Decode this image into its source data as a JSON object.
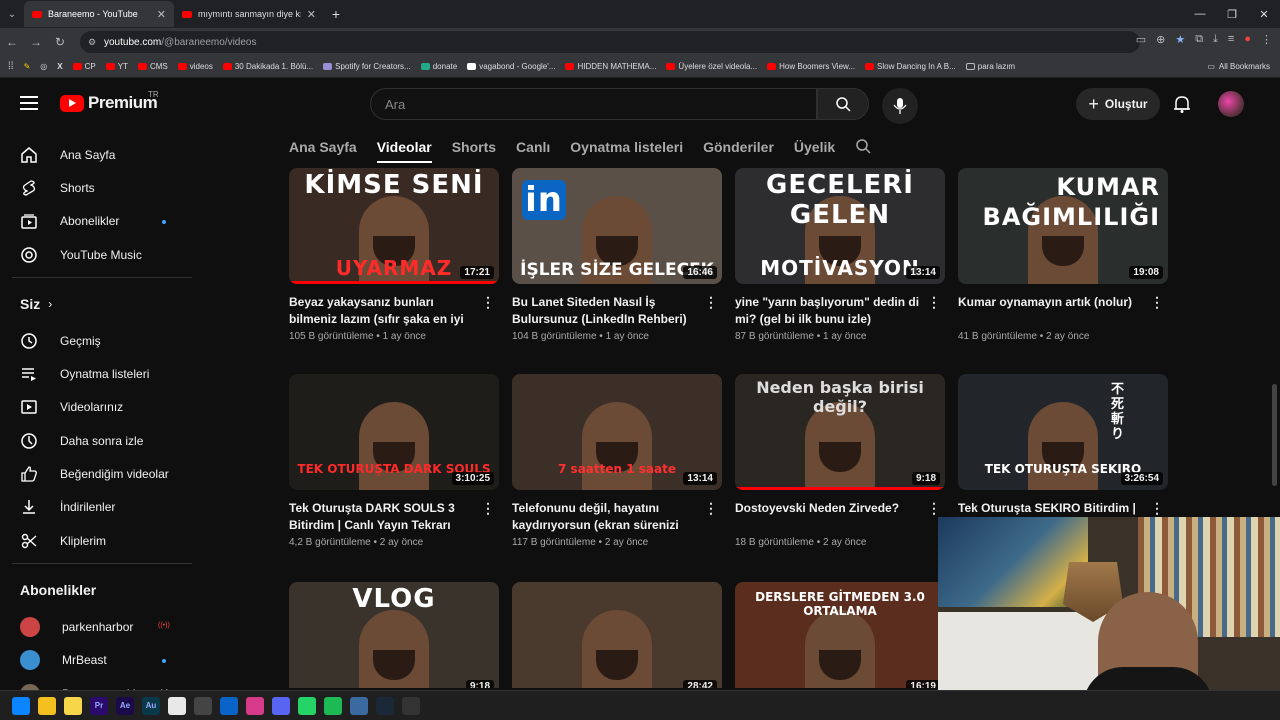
{
  "browser": {
    "tabs": [
      {
        "title": "Baraneemo - YouTube",
        "active": true
      },
      {
        "title": "mıymıntı sanmayın diye kıymay",
        "active": false
      }
    ],
    "url_host": "youtube.com",
    "url_path": "/@baraneemo/videos",
    "bookmarks": [
      "CP",
      "YT",
      "CMS",
      "videos",
      "30 Dakikada 1. Bölü...",
      "Spotify for Creators...",
      "donate",
      "vagabond - Google'...",
      "HIDDEN MATHEMA...",
      "Üyelere özel videola...",
      "How Boomers View...",
      "Slow Dancing In A B...",
      "para lazım"
    ],
    "all_bookmarks": "All Bookmarks"
  },
  "header": {
    "logo_word": "Premium",
    "country": "TR",
    "search_placeholder": "Ara",
    "create_label": "Oluştur"
  },
  "sidebar": {
    "main": [
      {
        "label": "Ana Sayfa",
        "icon": "home-icon"
      },
      {
        "label": "Shorts",
        "icon": "shorts-icon"
      },
      {
        "label": "Abonelikler",
        "icon": "subscriptions-icon",
        "dot": true
      },
      {
        "label": "YouTube Music",
        "icon": "music-icon"
      }
    ],
    "you_heading": "Siz",
    "you": [
      {
        "label": "Geçmiş",
        "icon": "history-icon"
      },
      {
        "label": "Oynatma listeleri",
        "icon": "playlists-icon"
      },
      {
        "label": "Videolarınız",
        "icon": "your-videos-icon"
      },
      {
        "label": "Daha sonra izle",
        "icon": "watch-later-icon"
      },
      {
        "label": "Beğendiğim videolar",
        "icon": "liked-icon"
      },
      {
        "label": "İndirilenler",
        "icon": "downloads-icon"
      },
      {
        "label": "Kliplerim",
        "icon": "clips-icon"
      }
    ],
    "subs_heading": "Abonelikler",
    "subs": [
      {
        "label": "parkenharbor",
        "live": true
      },
      {
        "label": "MrBeast",
        "dot": true
      },
      {
        "label": "Baraneemo Yayın K..."
      }
    ]
  },
  "channel_tabs": [
    "Ana Sayfa",
    "Videolar",
    "Shorts",
    "Canlı",
    "Oynatma listeleri",
    "Gönderiler",
    "Üyelik"
  ],
  "active_tab": "Videolar",
  "colors": {
    "accent": "#ff0000",
    "link_blue": "#3ea6ff",
    "bg": "#0f0f0f"
  },
  "videos": [
    {
      "title": "Beyaz yakaysanız bunları bilmeniz lazım (sıfır şaka en iyi tavsiye...",
      "views": "105 B görüntüleme",
      "age": "1 ay önce",
      "duration": "17:21",
      "thumb_top": "KİMSE SENİ",
      "thumb_bottom": "UYARMAZ",
      "bg": "#3a2a24",
      "bottom_color": "#ff2a2a",
      "progress": 1.0
    },
    {
      "title": "Bu Lanet Siteden Nasıl İş Bulursunuz (LinkedIn Rehberi)",
      "views": "104 B görüntüleme",
      "age": "1 ay önce",
      "duration": "16:46",
      "thumb_top": "in",
      "thumb_bottom": "İŞLER SİZE GELECEK",
      "bg": "#5a5048",
      "bottom_color": "#ffffff",
      "progress": 0.0
    },
    {
      "title": "yine \"yarın başlıyorum\" dedin di mi? (gel bi ilk bunu izle)",
      "views": "87 B görüntüleme",
      "age": "1 ay önce",
      "duration": "13:14",
      "thumb_top": "GECELERİ GELEN",
      "thumb_bottom": "MOTİVASYON",
      "bg": "#2d2d30",
      "bottom_color": "#ffffff",
      "progress": 0.0
    },
    {
      "title": "Kumar oynamayın artık (nolur)",
      "views": "41 B görüntüleme",
      "age": "2 ay önce",
      "duration": "19:08",
      "thumb_top": "KUMAR BAĞIMLILIĞI",
      "thumb_bottom": "",
      "bg": "#2a2e2c",
      "bottom_color": "#ffffff",
      "progress": 0.0
    },
    {
      "title": "Tek Oturuşta DARK SOULS 3 Bitirdim | Canlı Yayın Tekrarı",
      "views": "4,2 B görüntüleme",
      "age": "2 ay önce",
      "duration": "3:10:25",
      "thumb_top": "",
      "thumb_bottom": "TEK OTURUŞTA DARK SOULS",
      "bg": "#1e1d1a",
      "bottom_color": "#ff2a2a",
      "progress": 0.0
    },
    {
      "title": "Telefonunu değil, hayatını kaydırıyorsun (ekran sürenizi yok...",
      "views": "117 B görüntüleme",
      "age": "2 ay önce",
      "duration": "13:14",
      "thumb_top": "",
      "thumb_bottom": "7 saatten 1 saate",
      "bg": "#3b2f28",
      "bottom_color": "#ff3030",
      "progress": 0.0
    },
    {
      "title": "Dostoyevski Neden Zirvede?",
      "views": "18 B görüntüleme",
      "age": "2 ay önce",
      "duration": "9:18",
      "thumb_top": "Neden başka birisi değil?",
      "thumb_bottom": "",
      "bg": "#2a2622",
      "bottom_color": "#ffffff",
      "progress": 1.0
    },
    {
      "title": "Tek Oturuşta SEKIRO Bitirdim | Canlı Yayın Tekrarı",
      "views": "",
      "age": "",
      "duration": "3:26:54",
      "thumb_top": "不 死 斬 り",
      "thumb_bottom": "TEK OTURUŞTA SEKIRO",
      "bg": "#22262a",
      "bottom_color": "#ffffff",
      "progress": 0.0
    },
    {
      "title": "",
      "views": "",
      "age": "",
      "duration": "9:18",
      "thumb_top": "VLOG",
      "thumb_bottom": "",
      "bg": "#3a332c",
      "bottom_color": "#ffffff",
      "progress": 0.0
    },
    {
      "title": "",
      "views": "",
      "age": "",
      "duration": "28:42",
      "thumb_top": "",
      "thumb_bottom": "",
      "bg": "#4a3a2e",
      "bottom_color": "#ffffff",
      "progress": 0.0
    },
    {
      "title": "",
      "views": "",
      "age": "",
      "duration": "16:19",
      "thumb_top": "DERSLERE GİTMEDEN 3.0 ORTALAMA",
      "thumb_bottom": "",
      "bg": "#5a2d1e",
      "bottom_color": "#ffffff",
      "progress": 0.0
    }
  ],
  "taskbar": [
    "windows-icon",
    "file-explorer-icon",
    "sticky-notes-icon",
    "premiere-icon",
    "after-effects-icon",
    "audition-icon",
    "chrome-icon",
    "app-icon",
    "outlook-icon",
    "instagram-icon",
    "discord-icon",
    "whatsapp-icon",
    "spotify-icon",
    "network-icon",
    "steam-icon",
    "obs-icon"
  ],
  "taskbar_labels": {
    "premiere-icon": "Pr",
    "after-effects-icon": "Ae",
    "audition-icon": "Au"
  }
}
